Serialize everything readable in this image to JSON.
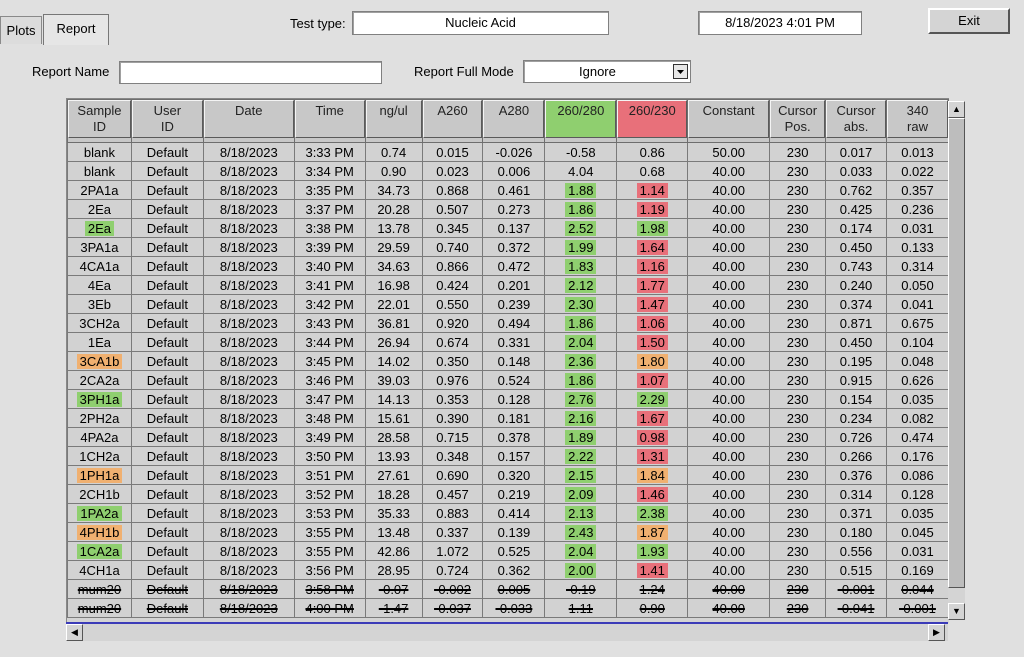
{
  "tabs": [
    {
      "label": "Plots"
    },
    {
      "label": "Report"
    }
  ],
  "header": {
    "test_type_label": "Test type:",
    "test_type_value": "Nucleic Acid",
    "datetime": "8/18/2023  4:01 PM",
    "exit_label": "Exit"
  },
  "report": {
    "name_label": "Report Name",
    "name_value": "",
    "full_mode_label": "Report Full Mode",
    "full_mode_value": "Ignore"
  },
  "colors": {
    "green": "#8fcf6f",
    "red": "#e8707a",
    "orange": "#f0b070"
  },
  "table": {
    "columns": [
      [
        "Sample",
        "ID"
      ],
      [
        "User",
        "ID"
      ],
      [
        "Date"
      ],
      [
        "Time"
      ],
      [
        "ng/ul"
      ],
      [
        "A260"
      ],
      [
        "A280"
      ],
      [
        "260/280"
      ],
      [
        "260/230"
      ],
      [
        "Constant"
      ],
      [
        "Cursor",
        "Pos."
      ],
      [
        "Cursor",
        "abs."
      ],
      [
        "340",
        "raw"
      ]
    ],
    "header_highlights": {
      "7": "green",
      "8": "red"
    },
    "rows": [
      {
        "c": [
          "blank",
          "Default",
          "8/18/2023",
          "3:33 PM",
          "0.74",
          "0.015",
          "-0.026",
          "-0.58",
          "0.86",
          "50.00",
          "230",
          "0.017",
          "0.013"
        ]
      },
      {
        "c": [
          "blank",
          "Default",
          "8/18/2023",
          "3:34 PM",
          "0.90",
          "0.023",
          "0.006",
          "4.04",
          "0.68",
          "40.00",
          "230",
          "0.033",
          "0.022"
        ]
      },
      {
        "c": [
          "2PA1a",
          "Default",
          "8/18/2023",
          "3:35 PM",
          "34.73",
          "0.868",
          "0.461",
          "1.88",
          "1.14",
          "40.00",
          "230",
          "0.762",
          "0.357"
        ],
        "h": {
          "7": "green",
          "8": "red"
        }
      },
      {
        "c": [
          "2Ea",
          "Default",
          "8/18/2023",
          "3:37 PM",
          "20.28",
          "0.507",
          "0.273",
          "1.86",
          "1.19",
          "40.00",
          "230",
          "0.425",
          "0.236"
        ],
        "h": {
          "7": "green",
          "8": "red"
        }
      },
      {
        "c": [
          "2Ea",
          "Default",
          "8/18/2023",
          "3:38 PM",
          "13.78",
          "0.345",
          "0.137",
          "2.52",
          "1.98",
          "40.00",
          "230",
          "0.174",
          "0.031"
        ],
        "h": {
          "0": "green",
          "7": "green",
          "8": "green"
        }
      },
      {
        "c": [
          "3PA1a",
          "Default",
          "8/18/2023",
          "3:39 PM",
          "29.59",
          "0.740",
          "0.372",
          "1.99",
          "1.64",
          "40.00",
          "230",
          "0.450",
          "0.133"
        ],
        "h": {
          "7": "green",
          "8": "red"
        }
      },
      {
        "c": [
          "4CA1a",
          "Default",
          "8/18/2023",
          "3:40 PM",
          "34.63",
          "0.866",
          "0.472",
          "1.83",
          "1.16",
          "40.00",
          "230",
          "0.743",
          "0.314"
        ],
        "h": {
          "7": "green",
          "8": "red"
        }
      },
      {
        "c": [
          "4Ea",
          "Default",
          "8/18/2023",
          "3:41 PM",
          "16.98",
          "0.424",
          "0.201",
          "2.12",
          "1.77",
          "40.00",
          "230",
          "0.240",
          "0.050"
        ],
        "h": {
          "7": "green",
          "8": "red"
        }
      },
      {
        "c": [
          "3Eb",
          "Default",
          "8/18/2023",
          "3:42 PM",
          "22.01",
          "0.550",
          "0.239",
          "2.30",
          "1.47",
          "40.00",
          "230",
          "0.374",
          "0.041"
        ],
        "h": {
          "7": "green",
          "8": "red"
        }
      },
      {
        "c": [
          "3CH2a",
          "Default",
          "8/18/2023",
          "3:43 PM",
          "36.81",
          "0.920",
          "0.494",
          "1.86",
          "1.06",
          "40.00",
          "230",
          "0.871",
          "0.675"
        ],
        "h": {
          "7": "green",
          "8": "red"
        }
      },
      {
        "c": [
          "1Ea",
          "Default",
          "8/18/2023",
          "3:44 PM",
          "26.94",
          "0.674",
          "0.331",
          "2.04",
          "1.50",
          "40.00",
          "230",
          "0.450",
          "0.104"
        ],
        "h": {
          "7": "green",
          "8": "red"
        }
      },
      {
        "c": [
          "3CA1b",
          "Default",
          "8/18/2023",
          "3:45 PM",
          "14.02",
          "0.350",
          "0.148",
          "2.36",
          "1.80",
          "40.00",
          "230",
          "0.195",
          "0.048"
        ],
        "h": {
          "0": "orange",
          "7": "green",
          "8": "orange"
        }
      },
      {
        "c": [
          "2CA2a",
          "Default",
          "8/18/2023",
          "3:46 PM",
          "39.03",
          "0.976",
          "0.524",
          "1.86",
          "1.07",
          "40.00",
          "230",
          "0.915",
          "0.626"
        ],
        "h": {
          "7": "green",
          "8": "red"
        }
      },
      {
        "c": [
          "3PH1a",
          "Default",
          "8/18/2023",
          "3:47 PM",
          "14.13",
          "0.353",
          "0.128",
          "2.76",
          "2.29",
          "40.00",
          "230",
          "0.154",
          "0.035"
        ],
        "h": {
          "0": "green",
          "7": "green",
          "8": "green"
        }
      },
      {
        "c": [
          "2PH2a",
          "Default",
          "8/18/2023",
          "3:48 PM",
          "15.61",
          "0.390",
          "0.181",
          "2.16",
          "1.67",
          "40.00",
          "230",
          "0.234",
          "0.082"
        ],
        "h": {
          "7": "green",
          "8": "red"
        }
      },
      {
        "c": [
          "4PA2a",
          "Default",
          "8/18/2023",
          "3:49 PM",
          "28.58",
          "0.715",
          "0.378",
          "1.89",
          "0.98",
          "40.00",
          "230",
          "0.726",
          "0.474"
        ],
        "h": {
          "7": "green",
          "8": "red"
        }
      },
      {
        "c": [
          "1CH2a",
          "Default",
          "8/18/2023",
          "3:50 PM",
          "13.93",
          "0.348",
          "0.157",
          "2.22",
          "1.31",
          "40.00",
          "230",
          "0.266",
          "0.176"
        ],
        "h": {
          "7": "green",
          "8": "red"
        }
      },
      {
        "c": [
          "1PH1a",
          "Default",
          "8/18/2023",
          "3:51 PM",
          "27.61",
          "0.690",
          "0.320",
          "2.15",
          "1.84",
          "40.00",
          "230",
          "0.376",
          "0.086"
        ],
        "h": {
          "0": "orange",
          "7": "green",
          "8": "orange"
        }
      },
      {
        "c": [
          "2CH1b",
          "Default",
          "8/18/2023",
          "3:52 PM",
          "18.28",
          "0.457",
          "0.219",
          "2.09",
          "1.46",
          "40.00",
          "230",
          "0.314",
          "0.128"
        ],
        "h": {
          "7": "green",
          "8": "red"
        }
      },
      {
        "c": [
          "1PA2a",
          "Default",
          "8/18/2023",
          "3:53 PM",
          "35.33",
          "0.883",
          "0.414",
          "2.13",
          "2.38",
          "40.00",
          "230",
          "0.371",
          "0.035"
        ],
        "h": {
          "0": "green",
          "7": "green",
          "8": "green"
        }
      },
      {
        "c": [
          "4PH1b",
          "Default",
          "8/18/2023",
          "3:55 PM",
          "13.48",
          "0.337",
          "0.139",
          "2.43",
          "1.87",
          "40.00",
          "230",
          "0.180",
          "0.045"
        ],
        "h": {
          "0": "orange",
          "7": "green",
          "8": "orange"
        }
      },
      {
        "c": [
          "1CA2a",
          "Default",
          "8/18/2023",
          "3:55 PM",
          "42.86",
          "1.072",
          "0.525",
          "2.04",
          "1.93",
          "40.00",
          "230",
          "0.556",
          "0.031"
        ],
        "h": {
          "0": "green",
          "7": "green",
          "8": "green"
        }
      },
      {
        "c": [
          "4CH1a",
          "Default",
          "8/18/2023",
          "3:56 PM",
          "28.95",
          "0.724",
          "0.362",
          "2.00",
          "1.41",
          "40.00",
          "230",
          "0.515",
          "0.169"
        ],
        "h": {
          "7": "green",
          "8": "red"
        }
      },
      {
        "c": [
          "mum20",
          "Default",
          "8/18/2023",
          "3:58 PM",
          "-0.07",
          "-0.002",
          "0.005",
          "-0.19",
          "1.24",
          "40.00",
          "230",
          "-0.001",
          "0.044"
        ],
        "struck": true
      },
      {
        "c": [
          "mum20",
          "Default",
          "8/18/2023",
          "4:00 PM",
          "-1.47",
          "-0.037",
          "-0.033",
          "1.11",
          "0.90",
          "40.00",
          "230",
          "-0.041",
          "-0.001"
        ],
        "struck": true
      }
    ]
  },
  "icons": {
    "scroll_up": "▲",
    "scroll_down": "▼",
    "scroll_left": "◀",
    "scroll_right": "▶",
    "dropdown": "▼"
  }
}
